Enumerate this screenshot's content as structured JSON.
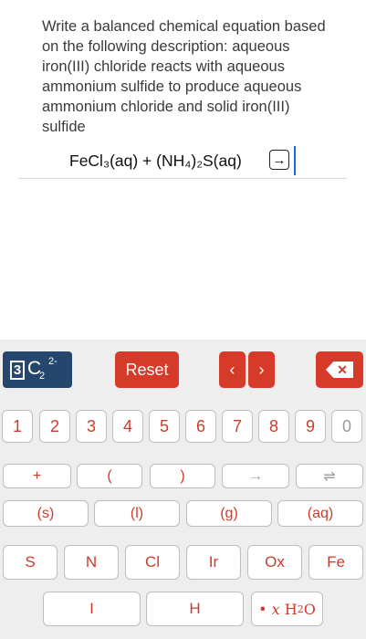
{
  "question": {
    "text": "Write a balanced chemical equation based on the following description: aqueous iron(III) chloride reacts with aqueous ammonium sulfide to produce aqueous ammonium chloride and solid iron(III) sulfide"
  },
  "equation": {
    "text": "FeCl₃(aq) + (NH₄)₂S(aq)",
    "arrow": "→"
  },
  "keyboard": {
    "sup_sub": {
      "box": "3",
      "letter": "C",
      "sub": "2",
      "sup": "2-"
    },
    "reset": "Reset",
    "left": "‹",
    "right": "›",
    "backspace": "✕",
    "numbers": [
      "1",
      "2",
      "3",
      "4",
      "5",
      "6",
      "7",
      "8",
      "9",
      "0"
    ],
    "ops": [
      "+",
      "(",
      ")",
      "→",
      "⇌"
    ],
    "states": [
      "(s)",
      "(l)",
      "(g)",
      "(aq)"
    ],
    "elements_row1": [
      "S",
      "N",
      "Cl",
      "Ir",
      "Ox",
      "Fe"
    ],
    "elements_row2": [
      "I",
      "H"
    ],
    "water": {
      "dot": "•",
      "x": "x",
      "h": "H",
      "sub": "2",
      "o": "O"
    }
  }
}
